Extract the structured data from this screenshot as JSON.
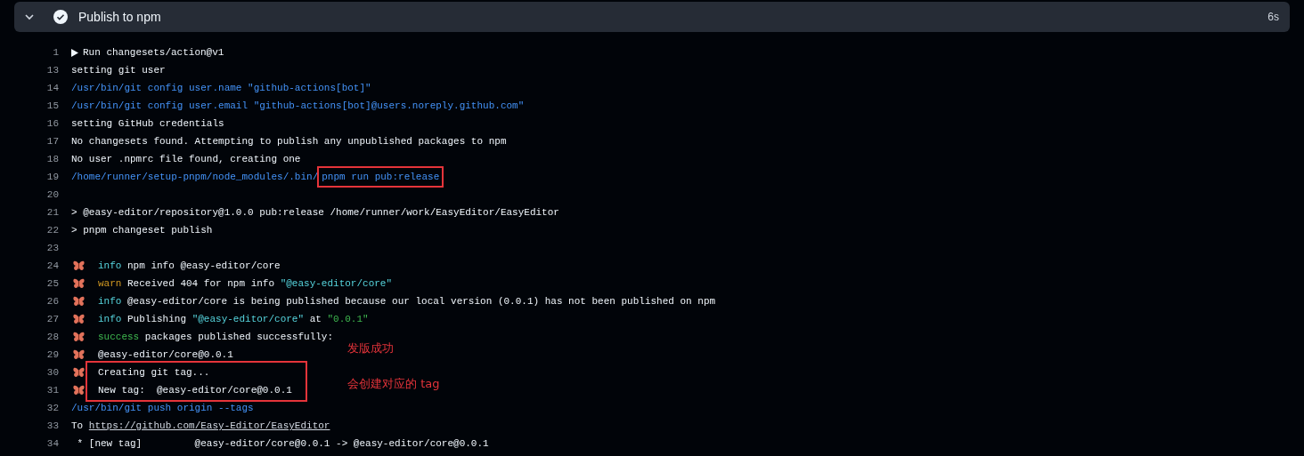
{
  "step": {
    "title": "Publish to npm",
    "duration": "6s",
    "expanded": true,
    "succeeded": true
  },
  "log": [
    {
      "number": "1",
      "kind": "group",
      "segments": [
        {
          "text": "Run changesets/action@v1",
          "kind": "plain"
        }
      ]
    },
    {
      "number": "13",
      "segments": [
        {
          "text": "setting git user",
          "kind": "plain"
        }
      ]
    },
    {
      "number": "14",
      "segments": [
        {
          "text": "/usr/bin/git config user.name \"github-actions[bot]\"",
          "kind": "command"
        }
      ]
    },
    {
      "number": "15",
      "segments": [
        {
          "text": "/usr/bin/git config user.email \"github-actions[bot]@users.noreply.github.com\"",
          "kind": "command"
        }
      ]
    },
    {
      "number": "16",
      "segments": [
        {
          "text": "setting GitHub credentials",
          "kind": "plain"
        }
      ]
    },
    {
      "number": "17",
      "segments": [
        {
          "text": "No changesets found. Attempting to publish any unpublished packages to npm",
          "kind": "plain"
        }
      ]
    },
    {
      "number": "18",
      "segments": [
        {
          "text": "No user .npmrc file found, creating one",
          "kind": "plain"
        }
      ]
    },
    {
      "number": "19",
      "segments": [
        {
          "text": "/home/runner/setup-pnpm/node_modules/.bin/",
          "kind": "command"
        },
        {
          "text": "pnpm run pub:release",
          "kind": "command",
          "highlighted": true
        }
      ]
    },
    {
      "number": "20"
    },
    {
      "number": "21",
      "segments": [
        {
          "text": "> @easy-editor/repository@1.0.0 pub:release /home/runner/work/EasyEditor/EasyEditor",
          "kind": "plain"
        }
      ]
    },
    {
      "number": "22",
      "segments": [
        {
          "text": "> pnpm changeset publish",
          "kind": "plain"
        }
      ]
    },
    {
      "number": "23"
    },
    {
      "number": "24",
      "butterfly": true,
      "segments": [
        {
          "text": "info",
          "kind": "info"
        },
        {
          "text": " npm info @easy-editor/core",
          "kind": "plain"
        }
      ]
    },
    {
      "number": "25",
      "butterfly": true,
      "segments": [
        {
          "text": "warn",
          "kind": "warn"
        },
        {
          "text": " Received 404 for npm info ",
          "kind": "plain"
        },
        {
          "text": "\"@easy-editor/core\"",
          "kind": "string"
        }
      ]
    },
    {
      "number": "26",
      "butterfly": true,
      "segments": [
        {
          "text": "info",
          "kind": "info"
        },
        {
          "text": " @easy-editor/core is being published because our local version (0.0.1) has not been published on npm",
          "kind": "plain"
        }
      ]
    },
    {
      "number": "27",
      "butterfly": true,
      "segments": [
        {
          "text": "info",
          "kind": "info"
        },
        {
          "text": " Publishing ",
          "kind": "plain"
        },
        {
          "text": "\"@easy-editor/core\"",
          "kind": "string"
        },
        {
          "text": " at ",
          "kind": "plain"
        },
        {
          "text": "\"0.0.1\"",
          "kind": "version"
        }
      ]
    },
    {
      "number": "28",
      "butterfly": true,
      "segments": [
        {
          "text": "success",
          "kind": "success"
        },
        {
          "text": " packages published successfully:",
          "kind": "plain"
        }
      ]
    },
    {
      "number": "29",
      "butterfly": true,
      "note": "发版成功",
      "segments": [
        {
          "text": "@easy-editor/core@0.0.1",
          "kind": "plain"
        }
      ]
    },
    {
      "number": "30",
      "butterfly": true,
      "framed": true,
      "segments": [
        {
          "text": "Creating git tag...",
          "kind": "plain"
        }
      ]
    },
    {
      "number": "31",
      "butterfly": true,
      "framed": true,
      "note": "会创建对应的 tag",
      "segments": [
        {
          "text": "New tag:  @easy-editor/core@0.0.1",
          "kind": "plain"
        }
      ]
    },
    {
      "number": "32",
      "segments": [
        {
          "text": "/usr/bin/git push origin --tags",
          "kind": "command"
        }
      ]
    },
    {
      "number": "33",
      "segments": [
        {
          "text": "To ",
          "kind": "plain"
        },
        {
          "text": "https://github.com/Easy-Editor/EasyEditor",
          "kind": "link"
        }
      ]
    },
    {
      "number": "34",
      "segments": [
        {
          "text": " * [new tag]         @easy-editor/core@0.0.1 -> @easy-editor/core@0.0.1",
          "kind": "plain"
        }
      ]
    }
  ]
}
